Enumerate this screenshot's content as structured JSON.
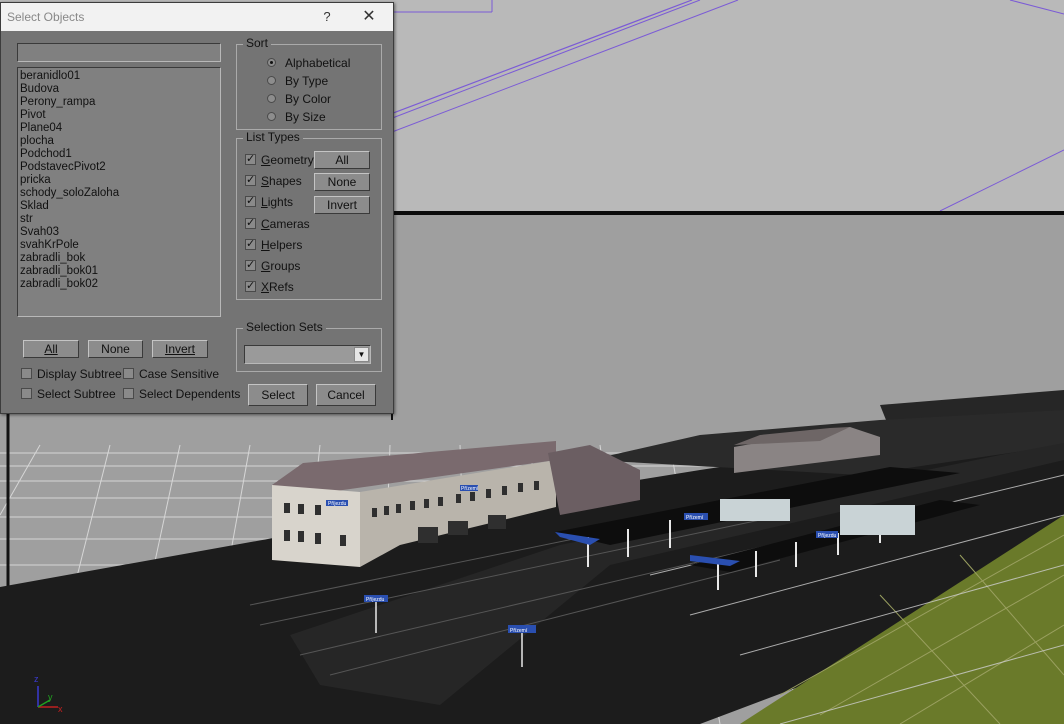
{
  "dialog": {
    "title": "Select Objects",
    "help_label": "?",
    "close_label": "✕",
    "search_value": "",
    "objects": [
      "beranidlo01",
      "Budova",
      "Perony_rampa",
      "Pivot",
      "Plane04",
      "plocha",
      "Podchod1",
      "PodstavecPivot2",
      "pricka",
      "schody_soloZaloha",
      "Sklad",
      "str",
      "Svah03",
      "svahKrPole",
      "zabradli_bok",
      "zabradli_bok01",
      "zabradli_bok02"
    ],
    "list_buttons": {
      "all": "All",
      "none": "None",
      "invert": "Invert"
    },
    "options": {
      "display_subtree": "Display Subtree",
      "case_sensitive": "Case Sensitive",
      "select_subtree": "Select Subtree",
      "select_dependents": "Select Dependents"
    },
    "sort": {
      "label": "Sort",
      "selected": "Alphabetical",
      "options": [
        "Alphabetical",
        "By Type",
        "By Color",
        "By Size"
      ]
    },
    "list_types": {
      "label": "List Types",
      "items": [
        {
          "pre": "",
          "key": "G",
          "rest": "eometry",
          "checked": true
        },
        {
          "pre": "",
          "key": "S",
          "rest": "hapes",
          "checked": true
        },
        {
          "pre": "",
          "key": "L",
          "rest": "ights",
          "checked": true
        },
        {
          "pre": "",
          "key": "C",
          "rest": "ameras",
          "checked": true
        },
        {
          "pre": "",
          "key": "H",
          "rest": "elpers",
          "checked": true
        },
        {
          "pre": "",
          "key": "G",
          "rest": "roups",
          "checked": true
        },
        {
          "pre": "",
          "key": "X",
          "rest": "Refs",
          "checked": true
        }
      ],
      "buttons": {
        "all": "All",
        "none": "None",
        "invert": "Invert"
      }
    },
    "selection_sets": {
      "label": "Selection Sets",
      "value": ""
    },
    "actions": {
      "select": "Select",
      "cancel": "Cancel"
    }
  },
  "viewport": {
    "signs": [
      "Příjezdu",
      "Přízemí",
      "Příjezdu",
      "Přízemí",
      "Přízemí",
      "Příjezdu"
    ]
  },
  "gizmo": {
    "z": "z",
    "y": "y",
    "x": "x"
  },
  "colors": {
    "dialog_bg": "#747474",
    "titlebar_bg": "#f2f2f2",
    "viewport_top": "#b9b9b9",
    "grid_line": "#d9d9d9",
    "ground": "#1c1c1c",
    "grass": "#6a7a2a",
    "roof": "#7a6a6e",
    "wall": "#d8d4cc",
    "sign_blue": "#2a4fb0",
    "selection_line": "#7b5bd6"
  }
}
